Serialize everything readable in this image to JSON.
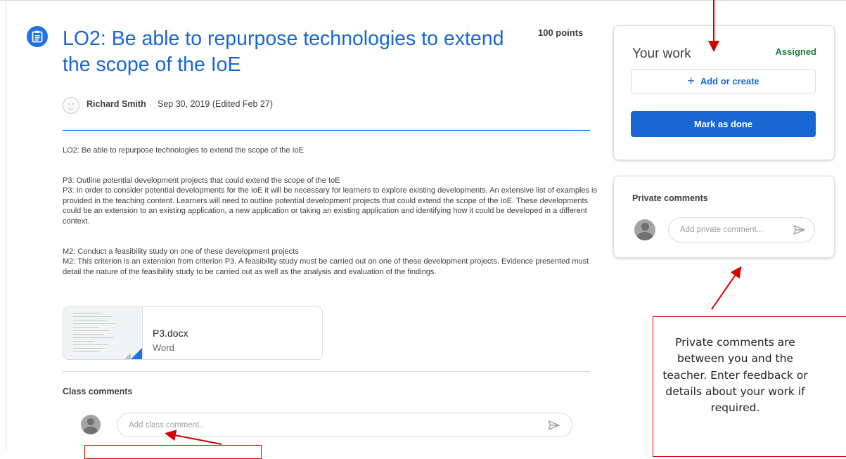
{
  "assignment": {
    "icon": "assignment-icon",
    "title": "LO2: Be able to repurpose technologies to extend the scope of the IoE",
    "points": "100 points",
    "author": "Richard Smith",
    "date": "Sep 30, 2019 (Edited Feb 27)"
  },
  "description": {
    "intro": "LO2: Be able to repurpose technologies to extend the scope of the IoE",
    "p3_heading": "P3: Outline potential development projects that could extend the scope of the IoE",
    "p3_body": "P3: In order to consider potential developments for the IoE it will be necessary for learners to explore existing developments. An extensive list of examples is provided in the teaching content. Learners will need to outline potential development projects that could extend the scope of the IoE. These developments could be an extension to an existing application, a new application or taking an existing application and identifying how it could be developed in a different context.",
    "m2_heading": "M2: Conduct a feasibility study on one of these development projects",
    "m2_body": "M2: This criterion is an extension from criterion P3. A feasibility study must be carried out on one of these development projects. Evidence presented must detail the nature of the feasibility study to be carried out as well as the analysis and evaluation of the findings."
  },
  "attachment": {
    "name": "P3.docx",
    "type": "Word"
  },
  "class_comments": {
    "title": "Class comments",
    "placeholder": "Add class comment...",
    "send_icon": "send-icon"
  },
  "your_work": {
    "title": "Your work",
    "status": "Assigned",
    "status_color": "#188038",
    "add_label": "Add or create",
    "add_icon": "plus-icon",
    "done_label": "Mark as done",
    "accent": "#1967d2"
  },
  "private_comments": {
    "title": "Private comments",
    "placeholder": "Add private comment...",
    "send_icon": "send-icon"
  },
  "annotation": {
    "text": "Private comments are between you and the teacher. Enter feedback or details about your work if required.",
    "color": "#d40000"
  }
}
